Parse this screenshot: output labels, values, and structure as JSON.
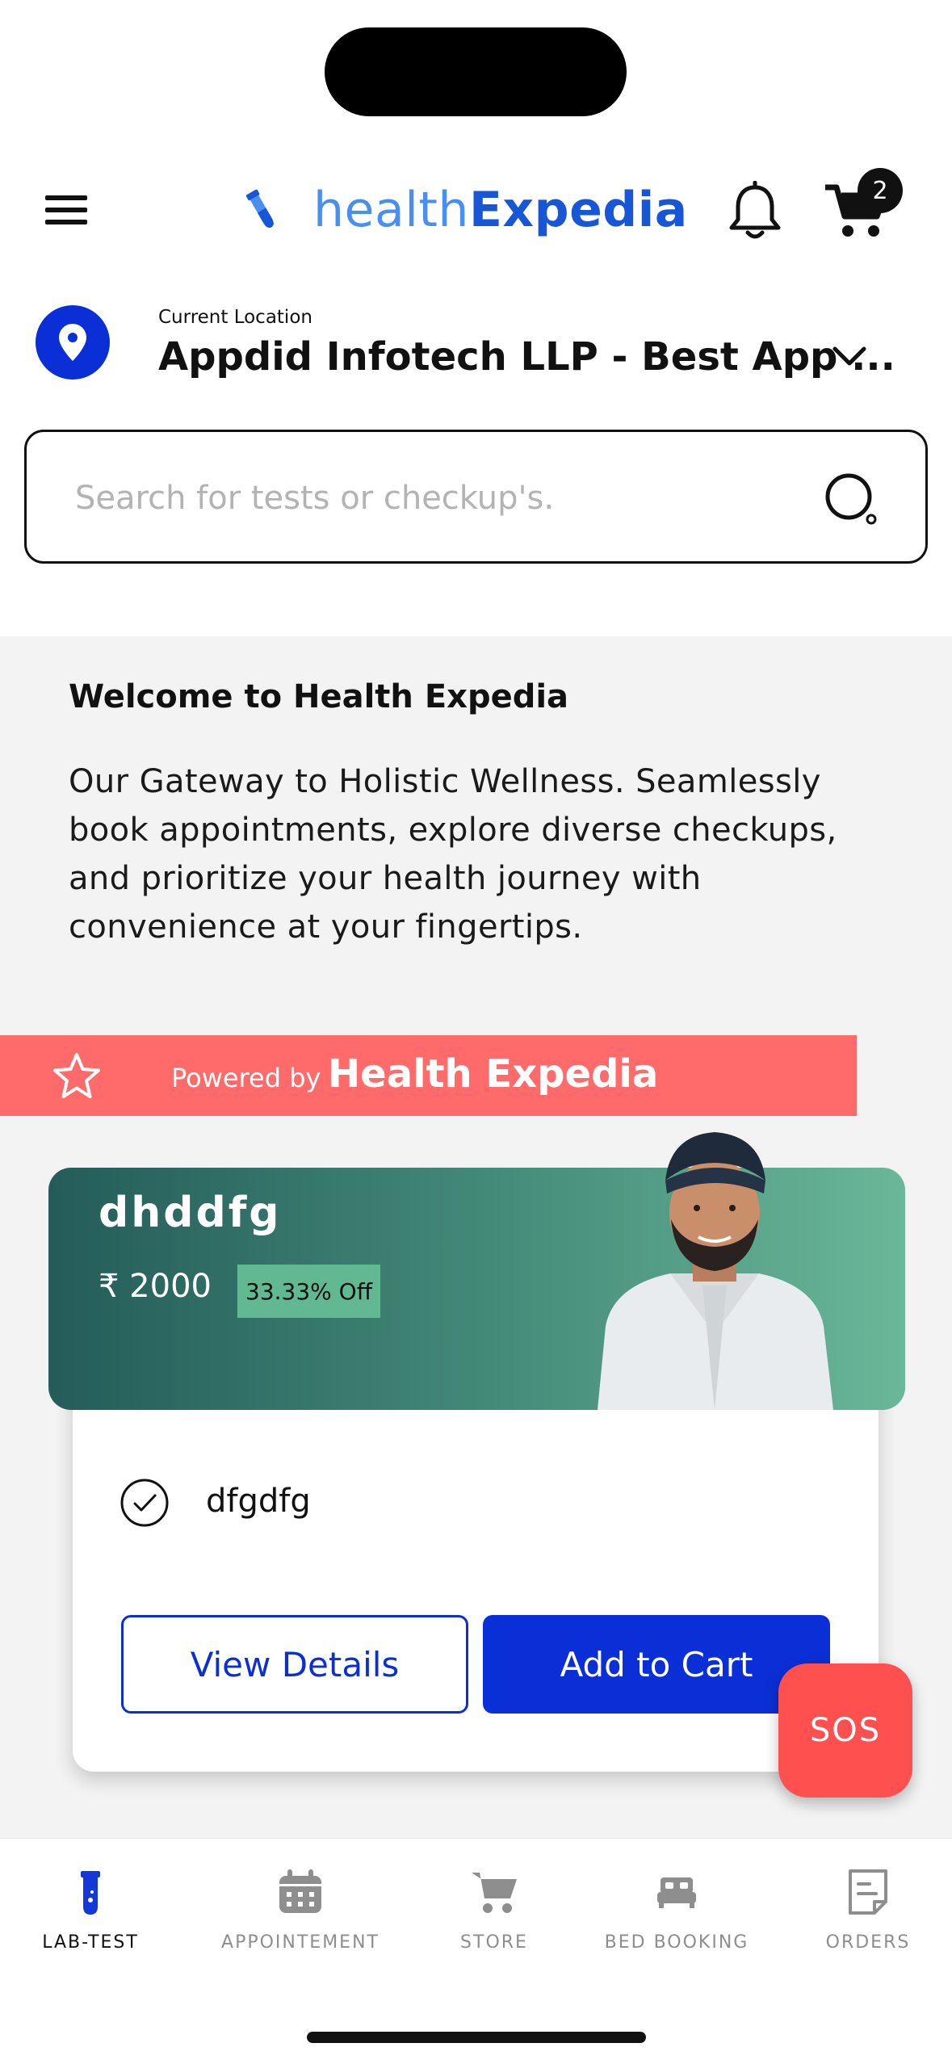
{
  "header": {
    "logo_part1": "health",
    "logo_part2": "Expedia",
    "cart_count": "2"
  },
  "location": {
    "caption": "Current Location",
    "name": "Appdid Infotech LLP - Best App ..."
  },
  "search": {
    "placeholder": "Search for tests or checkup's."
  },
  "welcome": {
    "title": "Welcome to Health Expedia",
    "body": "Our Gateway to Holistic Wellness. Seamlessly book appointments, explore diverse checkups, and prioritize your health journey with convenience at your fingertips."
  },
  "powered": {
    "prefix": "Powered by",
    "brand": "Health Expedia"
  },
  "card": {
    "title": "dhddfg",
    "price": "₹ 2000",
    "discount": "33.33% Off",
    "item": "dfgdfg",
    "view_details": "View Details",
    "add_to_cart": "Add to Cart"
  },
  "sos_label": "SOS",
  "nav": {
    "lab_test": "LAB-TEST",
    "appointment": "APPOINTEMENT",
    "store": "STORE",
    "bed_booking": "BED BOOKING",
    "orders": "ORDERS"
  },
  "colors": {
    "primary": "#0a2fd6",
    "logo_light": "#4a8ef0",
    "powered_bg": "#ff6a6a",
    "sos_bg": "#ff5050",
    "card_gradient_start": "#245c59",
    "card_gradient_end": "#6ab799"
  }
}
